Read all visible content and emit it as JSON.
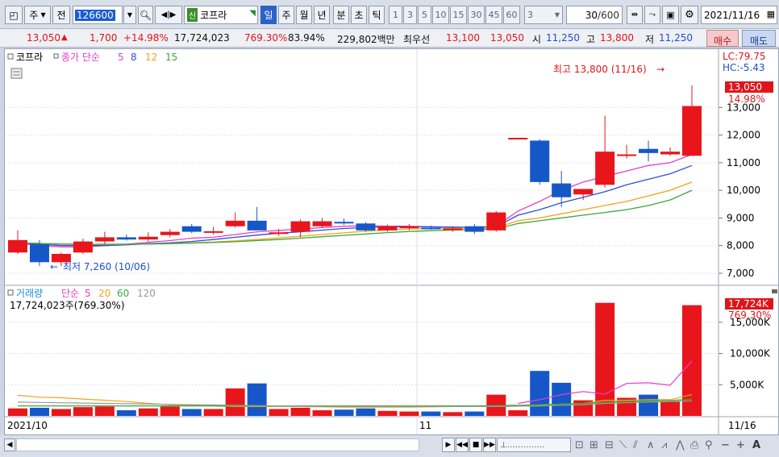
{
  "toolbar": {
    "market_select": "주",
    "view_select": "전",
    "code": "126600",
    "badge": "신",
    "name": "코프라",
    "periods": [
      "일",
      "주",
      "월",
      "년",
      "분",
      "초",
      "틱"
    ],
    "active_period": "일",
    "intervals": [
      "1",
      "3",
      "5",
      "10",
      "15",
      "30",
      "45",
      "60"
    ],
    "interval_select": "3",
    "count_value": "30",
    "count_total": "/600",
    "date": "2021/11/16"
  },
  "price": {
    "current": "13,050",
    "change": "1,700",
    "change_rate": "+14.98%",
    "volume": "17,724,023",
    "volume_rate": "769.30%",
    "turnover": "83.94%",
    "amount": "229,802백만",
    "priority_label": "최우선",
    "ask": "13,100",
    "bid": "13,050",
    "open_label": "시",
    "open": "11,250",
    "high_label": "고",
    "high": "13,800",
    "low_label": "저",
    "low": "11,250",
    "buy_label": "매수",
    "sell_label": "매도"
  },
  "price_panel": {
    "legend_name": "코프라",
    "legend_ma": "종가 단순",
    "ma_periods": [
      "5",
      "8",
      "12",
      "15"
    ],
    "ma_colors": [
      "#e83ccf",
      "#2c4fd8",
      "#f0a418",
      "#3aa83a"
    ],
    "lc": "LC:79.75",
    "hc": "HC:-5.43",
    "last_price": "13,050",
    "last_rate": "14.98%",
    "high_note": "최고 13,800 (11/16)",
    "low_note": "최저 7,260 (10/06)"
  },
  "volume_panel": {
    "legend_name": "거래량",
    "legend_ma": "단순",
    "ma_periods": [
      "5",
      "20",
      "60",
      "120"
    ],
    "ma_colors": [
      "#e83ccf",
      "#f0a418",
      "#3aa83a",
      "#9a9a9a"
    ],
    "info": "17,724,023주(769.30%)",
    "last_volume": "17,724K",
    "last_rate": "769.30%"
  },
  "x_axis": {
    "start": "2021/10",
    "mid": "11",
    "end": "11/16"
  },
  "chart_data": {
    "type": "candlestick",
    "price_ticks": [
      13000,
      12000,
      11000,
      10000,
      9000,
      8000,
      7000
    ],
    "price_tick_labels": [
      "13,000",
      "12,000",
      "11,000",
      "10,000",
      "9,000",
      "8,000",
      "7,000"
    ],
    "price_range": [
      6650,
      14700
    ],
    "volume_ticks": [
      15000,
      10000,
      5000
    ],
    "volume_tick_labels": [
      "15,000K",
      "10,000K",
      "5,000K"
    ],
    "volume_range": [
      0,
      20000
    ],
    "candles": [
      {
        "o": 7750,
        "h": 8550,
        "l": 7700,
        "c": 8200,
        "v": 1200
      },
      {
        "o": 8050,
        "h": 8200,
        "l": 7260,
        "c": 7400,
        "v": 1300
      },
      {
        "o": 7400,
        "h": 7750,
        "l": 7260,
        "c": 7700,
        "v": 1100
      },
      {
        "o": 7750,
        "h": 8250,
        "l": 7700,
        "c": 8150,
        "v": 1400
      },
      {
        "o": 8150,
        "h": 8500,
        "l": 8050,
        "c": 8300,
        "v": 1500
      },
      {
        "o": 8300,
        "h": 8400,
        "l": 8180,
        "c": 8220,
        "v": 900
      },
      {
        "o": 8220,
        "h": 8480,
        "l": 8150,
        "c": 8320,
        "v": 1200
      },
      {
        "o": 8380,
        "h": 8600,
        "l": 8300,
        "c": 8500,
        "v": 1500
      },
      {
        "o": 8700,
        "h": 8780,
        "l": 8450,
        "c": 8500,
        "v": 1100
      },
      {
        "o": 8500,
        "h": 8680,
        "l": 8400,
        "c": 8520,
        "v": 1100
      },
      {
        "o": 8700,
        "h": 9200,
        "l": 8650,
        "c": 8900,
        "v": 4400
      },
      {
        "o": 8900,
        "h": 9400,
        "l": 8600,
        "c": 8550,
        "v": 5200
      },
      {
        "o": 8450,
        "h": 8600,
        "l": 8350,
        "c": 8480,
        "v": 1100
      },
      {
        "o": 8500,
        "h": 8950,
        "l": 8300,
        "c": 8880,
        "v": 1300
      },
      {
        "o": 8700,
        "h": 9000,
        "l": 8650,
        "c": 8880,
        "v": 900
      },
      {
        "o": 8860,
        "h": 8980,
        "l": 8750,
        "c": 8820,
        "v": 1000
      },
      {
        "o": 8800,
        "h": 8850,
        "l": 8500,
        "c": 8550,
        "v": 1200
      },
      {
        "o": 8550,
        "h": 8760,
        "l": 8500,
        "c": 8700,
        "v": 800
      },
      {
        "o": 8630,
        "h": 8780,
        "l": 8560,
        "c": 8700,
        "v": 700
      },
      {
        "o": 8650,
        "h": 8720,
        "l": 8580,
        "c": 8620,
        "v": 700
      },
      {
        "o": 8600,
        "h": 8700,
        "l": 8500,
        "c": 8620,
        "v": 600
      },
      {
        "o": 8700,
        "h": 8780,
        "l": 8420,
        "c": 8500,
        "v": 700
      },
      {
        "o": 8550,
        "h": 9250,
        "l": 8500,
        "c": 9200,
        "v": 3400
      },
      {
        "o": 11900,
        "h": 11900,
        "l": 11880,
        "c": 11900,
        "v": 900
      },
      {
        "o": 11800,
        "h": 11850,
        "l": 10200,
        "c": 10300,
        "v": 7200
      },
      {
        "o": 10250,
        "h": 10700,
        "l": 9400,
        "c": 9750,
        "v": 5300
      },
      {
        "o": 9850,
        "h": 10000,
        "l": 9650,
        "c": 10050,
        "v": 2500
      },
      {
        "o": 10200,
        "h": 12700,
        "l": 10100,
        "c": 11400,
        "v": 18100
      },
      {
        "o": 11250,
        "h": 11650,
        "l": 11150,
        "c": 11300,
        "v": 2900
      },
      {
        "o": 11500,
        "h": 11800,
        "l": 11050,
        "c": 11350,
        "v": 3400
      },
      {
        "o": 11300,
        "h": 11550,
        "l": 11250,
        "c": 11400,
        "v": 2300
      },
      {
        "o": 11250,
        "h": 13800,
        "l": 11250,
        "c": 13050,
        "v": 17724
      }
    ],
    "ma5": [
      8100,
      8000,
      7950,
      7950,
      8000,
      8050,
      8120,
      8180,
      8270,
      8300,
      8400,
      8500,
      8550,
      8600,
      8650,
      8700,
      8720,
      8700,
      8700,
      8680,
      8660,
      8650,
      8700,
      9250,
      9600,
      10000,
      10300,
      10500,
      10700,
      10900,
      11000,
      11300
    ],
    "ma8": [
      8100,
      8050,
      8000,
      8000,
      8000,
      8030,
      8070,
      8100,
      8150,
      8220,
      8300,
      8380,
      8450,
      8500,
      8560,
      8620,
      8660,
      8680,
      8680,
      8680,
      8670,
      8660,
      8680,
      9100,
      9300,
      9550,
      9750,
      9950,
      10200,
      10400,
      10600,
      10900
    ],
    "ma12": [
      8100,
      8080,
      8050,
      8040,
      8040,
      8050,
      8060,
      8080,
      8100,
      8130,
      8170,
      8220,
      8280,
      8340,
      8400,
      8460,
      8520,
      8570,
      8600,
      8620,
      8630,
      8640,
      8650,
      8900,
      9000,
      9150,
      9300,
      9450,
      9600,
      9800,
      10000,
      10300
    ],
    "ma15": [
      8100,
      8080,
      8060,
      8050,
      8050,
      8050,
      8060,
      8070,
      8090,
      8110,
      8140,
      8180,
      8220,
      8270,
      8320,
      8370,
      8420,
      8470,
      8510,
      8540,
      8560,
      8580,
      8600,
      8800,
      8900,
      9000,
      9100,
      9200,
      9300,
      9450,
      9650,
      10000
    ],
    "vol_ma5": [
      null,
      null,
      null,
      null,
      null,
      null,
      null,
      null,
      null,
      null,
      null,
      null,
      null,
      null,
      null,
      null,
      null,
      null,
      null,
      null,
      null,
      null,
      null,
      2000,
      2600,
      3400,
      3900,
      3500,
      5200,
      5300,
      4900,
      8800
    ],
    "vol_ma20": [
      3300,
      3000,
      2900,
      2700,
      2500,
      2300,
      2000,
      1800,
      1700,
      1600,
      1500,
      1500,
      1500,
      1500,
      1450,
      1400,
      1400,
      1400,
      1400,
      1450,
      1500,
      1550,
      1600,
      1650,
      1700,
      1900,
      2000,
      2500,
      2500,
      2600,
      2600,
      3400
    ],
    "vol_ma60": [
      1600,
      1600,
      1600,
      1600,
      1600,
      1600,
      1600,
      1600,
      1600,
      1600,
      1600,
      1600,
      1600,
      1600,
      1600,
      1600,
      1600,
      1600,
      1600,
      1600,
      1600,
      1600,
      1650,
      1700,
      1800,
      1900,
      2000,
      2200,
      2300,
      2400,
      2450,
      2700
    ],
    "vol_ma120": [
      2200,
      2150,
      2100,
      2050,
      2000,
      1950,
      1900,
      1850,
      1800,
      1750,
      1700,
      1650,
      1600,
      1550,
      1500,
      1500,
      1500,
      1500,
      1500,
      1500,
      1500,
      1500,
      1500,
      1550,
      1600,
      1700,
      1800,
      2000,
      2100,
      2200,
      2300,
      2400
    ]
  }
}
